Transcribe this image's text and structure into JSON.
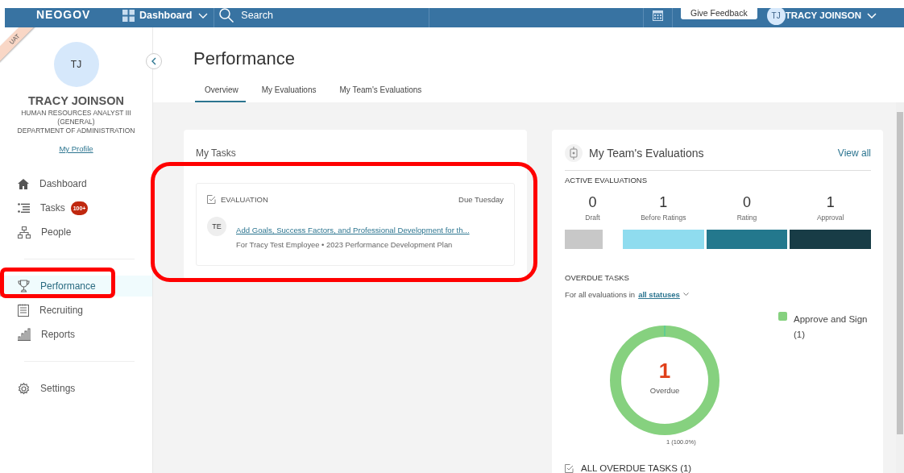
{
  "topbar": {
    "logo": "NEOGOV",
    "app_menu": "Dashboard",
    "search": {
      "placeholder": "Search"
    },
    "feedback_button": "Give Feedback",
    "user": {
      "initials": "TJ",
      "name": "TRACY JOINSON"
    }
  },
  "sidebar": {
    "env_badge": "UAT",
    "avatar_initials": "TJ",
    "name": "TRACY JOINSON",
    "job_title": "HUMAN RESOURCES ANALYST III (GENERAL)",
    "department": "DEPARTMENT OF ADMINISTRATION",
    "profile_link": "My Profile",
    "nav_groups": [
      [
        {
          "label": "Dashboard",
          "selected": false,
          "highlighted": false
        },
        {
          "label": "Tasks",
          "badge": "100+",
          "selected": false,
          "highlighted": false
        },
        {
          "label": "People",
          "selected": false,
          "highlighted": false
        }
      ],
      [
        {
          "label": "Performance",
          "selected": true,
          "highlighted": true
        },
        {
          "label": "Recruiting",
          "selected": false,
          "highlighted": false
        },
        {
          "label": "Reports",
          "selected": false,
          "highlighted": false
        }
      ],
      [
        {
          "label": "Settings",
          "selected": false,
          "highlighted": false
        }
      ]
    ]
  },
  "page": {
    "title": "Performance",
    "tabs": [
      {
        "label": "Overview",
        "selected": true
      },
      {
        "label": "My Evaluations",
        "selected": false
      },
      {
        "label": "My Team's Evaluations",
        "selected": false
      }
    ]
  },
  "tasks_card": {
    "title": "My Tasks",
    "highlighted": true,
    "tasks": [
      {
        "type": "EVALUATION",
        "due": "Due Tuesday",
        "initials": "TE",
        "link": "Add Goals, Success Factors, and Professional Development for th...",
        "subtitle": "For Tracy Test Employee • 2023 Performance Development Plan"
      }
    ]
  },
  "team_card": {
    "title": "My Team's Evaluations",
    "view_all": "View all",
    "active_heading": "ACTIVE EVALUATIONS",
    "stages": [
      {
        "count": "0",
        "label": "Draft",
        "color": "#c8c8c8"
      },
      {
        "count": "1",
        "label": "Before Ratings",
        "color": "#8fdcef"
      },
      {
        "count": "0",
        "label": "Rating",
        "color": "#23788d"
      },
      {
        "count": "1",
        "label": "Approval",
        "color": "#183c46"
      }
    ],
    "overdue": {
      "heading": "OVERDUE TASKS",
      "filter_prefix": "For all evaluations in",
      "filter_link": "all statuses",
      "center_value": "1",
      "center_label": "Overdue",
      "slice_label": "1 (100.0%)",
      "legend": [
        {
          "label": "Approve and Sign (1)",
          "color": "#86d17f"
        }
      ],
      "all_link": "ALL OVERDUE TASKS (1)"
    }
  }
}
